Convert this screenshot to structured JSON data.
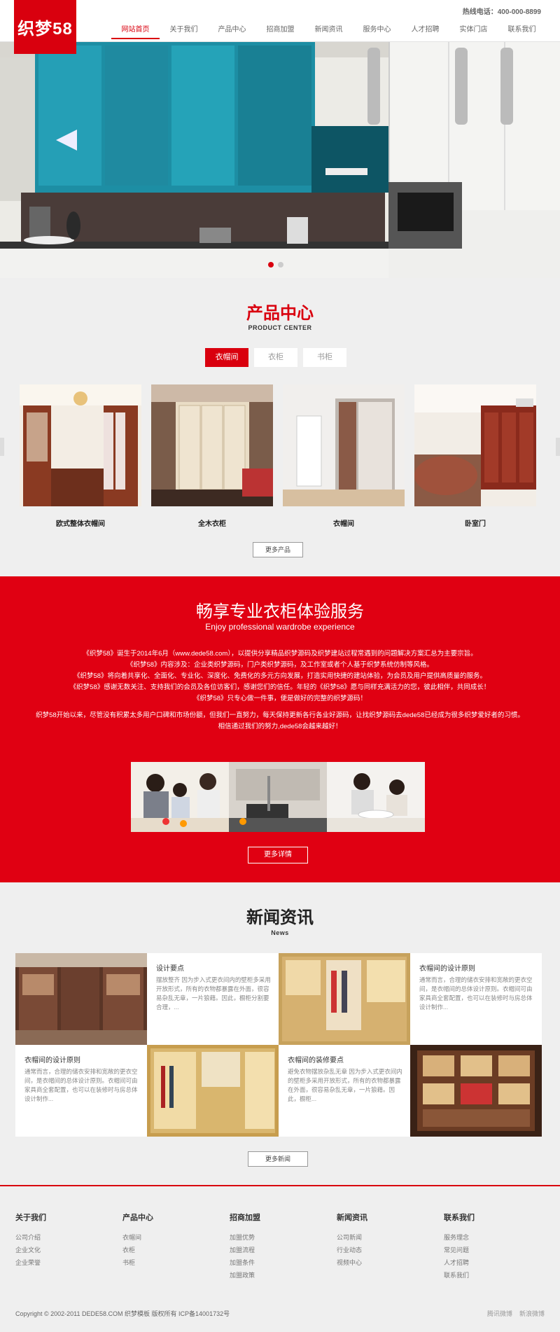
{
  "header": {
    "logo": "织梦58",
    "hotline": "热线电话：400-000-8899",
    "nav": [
      "网站首页",
      "关于我们",
      "产品中心",
      "招商加盟",
      "新闻资讯",
      "服务中心",
      "人才招聘",
      "实体门店",
      "联系我们"
    ]
  },
  "products": {
    "title": "产品中心",
    "subtitle": "PRODUCT CENTER",
    "tabs": [
      "衣帽间",
      "衣柜",
      "书柜"
    ],
    "items": [
      {
        "name": "欧式整体衣帽间"
      },
      {
        "name": "全木衣柜"
      },
      {
        "name": "衣帽间"
      },
      {
        "name": "卧室门"
      }
    ],
    "more": "更多产品"
  },
  "service": {
    "title": "畅享专业衣柜体验服务",
    "subtitle": "Enjoy professional wardrobe experience",
    "paragraphs": [
      "《织梦58》诞生于2014年6月（www.dede58.com），以提供分享精品织梦源码及织梦建站过程常遇到的问题解决方案汇总为主要宗旨。",
      "《织梦58》内容涉及：企业类织梦源码，门户类织梦源码，及工作室或者个人基于织梦系统仿制等风格。",
      "《织梦58》将向着共享化、全面化、专业化、深度化、免费化的多元方向发展，打造实用快捷的建站体验，为会员及用户提供高质量的服务。",
      "《织梦58》感谢无数关注、支持我们的会员及各位访客们，感谢您们的信任。年轻的《织梦58》愿与同样充满活力的您，彼此相伴，共同成长！",
      "《织梦58》只专心做一件事，便是做好的完整的织梦源码！",
      "织梦58开始以来，尽管没有积累太多用户口碑和市场份额，但我们一直努力，每天保持更新各行各业好源码，让找织梦源码去dede58已经成为很多织梦爱好者的习惯。",
      "相信通过我们的努力,dede58会越来越好！"
    ],
    "more": "更多详情"
  },
  "news": {
    "title": "新闻资讯",
    "subtitle": "News",
    "items": [
      {
        "title": "设计要点",
        "text": "摆放整齐 因为步入式更衣间内的壁柜多采用开放形式，所有的衣物都暴露在外面，很容易杂乱无章，一片狼藉。因此，橱柜分割要合理，..."
      },
      {
        "title": "衣帽间的设计原则",
        "text": "通常而言，合理的储衣安排和宽敞的更衣空间，是衣帽间的总体设计原则。衣帽间可由家具商全套配置，也可以在装修时与房总体设计制作..."
      },
      {
        "title": "衣帽间的设计原则",
        "text": "通常而言，合理的储衣安排和宽敞的更衣空间，是衣帽间的总体设计原则。衣帽间可由家具商全套配置，也可以在装修时与房总体设计制作..."
      },
      {
        "title": "衣帽间的装修要点",
        "text": "避免衣物摆放杂乱无章 因为步入式更衣间内的壁柜多采用开放形式，所有的衣物都暴露在外面，很容易杂乱无章，一片狼藉。因此，橱柜..."
      }
    ],
    "more": "更多新闻"
  },
  "footer": {
    "columns": [
      {
        "title": "关于我们",
        "links": [
          "公司介绍",
          "企业文化",
          "企业荣誉"
        ]
      },
      {
        "title": "产品中心",
        "links": [
          "衣帽间",
          "衣柜",
          "书柜"
        ]
      },
      {
        "title": "招商加盟",
        "links": [
          "加盟优势",
          "加盟流程",
          "加盟条件",
          "加盟政策"
        ]
      },
      {
        "title": "新闻资讯",
        "links": [
          "公司新闻",
          "行业动态",
          "视频中心"
        ]
      },
      {
        "title": "联系我们",
        "links": [
          "服务理念",
          "常见问题",
          "人才招聘",
          "联系我们"
        ]
      }
    ],
    "copyright": "Copyright © 2002-2011 DEDE58.COM 织梦模板 版权所有  ICP备14001732号",
    "social": [
      "腾讯微博",
      "新浪微博"
    ]
  },
  "colors": {
    "brand": "#d9000e",
    "background": "#efefef"
  }
}
